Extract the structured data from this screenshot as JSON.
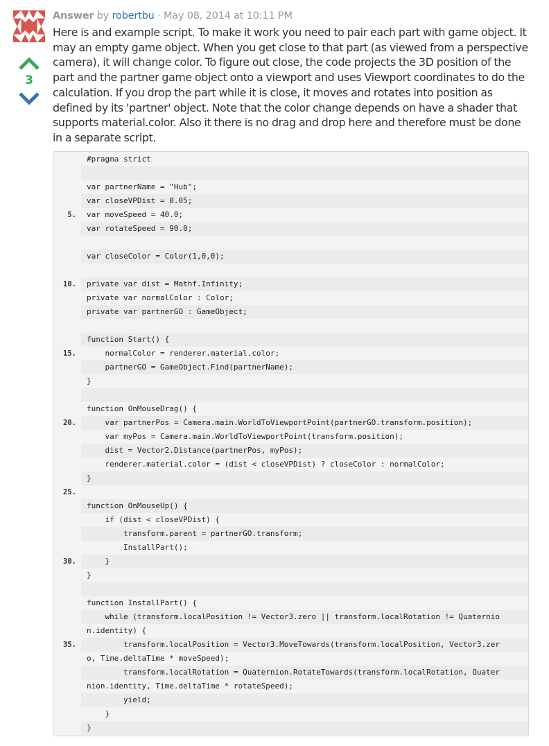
{
  "answer": {
    "label": "Answer",
    "by": "by",
    "author": "robertbu",
    "sep": "·",
    "timestamp": "May 08, 2014 at 10:11 PM",
    "votes": "3",
    "body": "Here is and example script. To make it work you need to pair each part with game object. It may an empty game object. When you get close to that part (as viewed from a perspective camera), it will change color. To figure out close, the code projects the 3D position of the part and the partner game object onto a viewport and uses Viewport coordinates to do the calculation. If you drop the part while it is close, it moves and rotates into position as defined by its 'partner' object. Note that the color change depends on have a shader that supports material.color. Also it there is no drag and drop here and therefore must be done in a separate script."
  },
  "colors": {
    "vote_arrow": "#3aa655",
    "vote_down_arrow": "#3b73af",
    "link": "#3b73af",
    "keyword": "#00008b",
    "string": "#006400",
    "number": "#a0522d"
  },
  "code_lines": [
    {
      "n": "",
      "t": "#pragma strict"
    },
    {
      "n": "",
      "t": ""
    },
    {
      "n": "",
      "t": "var partnerName = \"Hub\";"
    },
    {
      "n": "",
      "t": "var closeVPDist = 0.05;"
    },
    {
      "n": "5.",
      "t": "var moveSpeed = 40.0;"
    },
    {
      "n": "",
      "t": "var rotateSpeed = 90.0;"
    },
    {
      "n": "",
      "t": ""
    },
    {
      "n": "",
      "t": "var closeColor = Color(1,0,0);"
    },
    {
      "n": "",
      "t": ""
    },
    {
      "n": "10.",
      "t": "private var dist = Mathf.Infinity;"
    },
    {
      "n": "",
      "t": "private var normalColor : Color;"
    },
    {
      "n": "",
      "t": "private var partnerGO : GameObject;"
    },
    {
      "n": "",
      "t": ""
    },
    {
      "n": "",
      "t": "function Start() {"
    },
    {
      "n": "15.",
      "t": "    normalColor = renderer.material.color;"
    },
    {
      "n": "",
      "t": "    partnerGO = GameObject.Find(partnerName);"
    },
    {
      "n": "",
      "t": "}"
    },
    {
      "n": "",
      "t": ""
    },
    {
      "n": "",
      "t": "function OnMouseDrag() {"
    },
    {
      "n": "20.",
      "t": "    var partnerPos = Camera.main.WorldToViewportPoint(partnerGO.transform.position);"
    },
    {
      "n": "",
      "t": "    var myPos = Camera.main.WorldToViewportPoint(transform.position);"
    },
    {
      "n": "",
      "t": "    dist = Vector2.Distance(partnerPos, myPos);"
    },
    {
      "n": "",
      "t": "    renderer.material.color = (dist < closeVPDist) ? closeColor : normalColor;"
    },
    {
      "n": "",
      "t": "}"
    },
    {
      "n": "25.",
      "t": ""
    },
    {
      "n": "",
      "t": "function OnMouseUp() {"
    },
    {
      "n": "",
      "t": "    if (dist < closeVPDist) {"
    },
    {
      "n": "",
      "t": "        transform.parent = partnerGO.transform;"
    },
    {
      "n": "",
      "t": "        InstallPart();"
    },
    {
      "n": "30.",
      "t": "    }"
    },
    {
      "n": "",
      "t": "}"
    },
    {
      "n": "",
      "t": ""
    },
    {
      "n": "",
      "t": "function InstallPart() {"
    },
    {
      "n": "",
      "t": "    while (transform.localPosition != Vector3.zero || transform.localRotation != Quaternio"
    },
    {
      "n": "",
      "t": "n.identity) {"
    },
    {
      "n": "35.",
      "t": "        transform.localPosition = Vector3.MoveTowards(transform.localPosition, Vector3.zer"
    },
    {
      "n": "",
      "t": "o, Time.deltaTime * moveSpeed);"
    },
    {
      "n": "",
      "t": "        transform.localRotation = Quaternion.RotateTowards(transform.localRotation, Quater"
    },
    {
      "n": "",
      "t": "nion.identity, Time.deltaTime * rotateSpeed);"
    },
    {
      "n": "",
      "t": "        yield;"
    },
    {
      "n": "",
      "t": "    }"
    },
    {
      "n": "",
      "t": "}"
    }
  ]
}
